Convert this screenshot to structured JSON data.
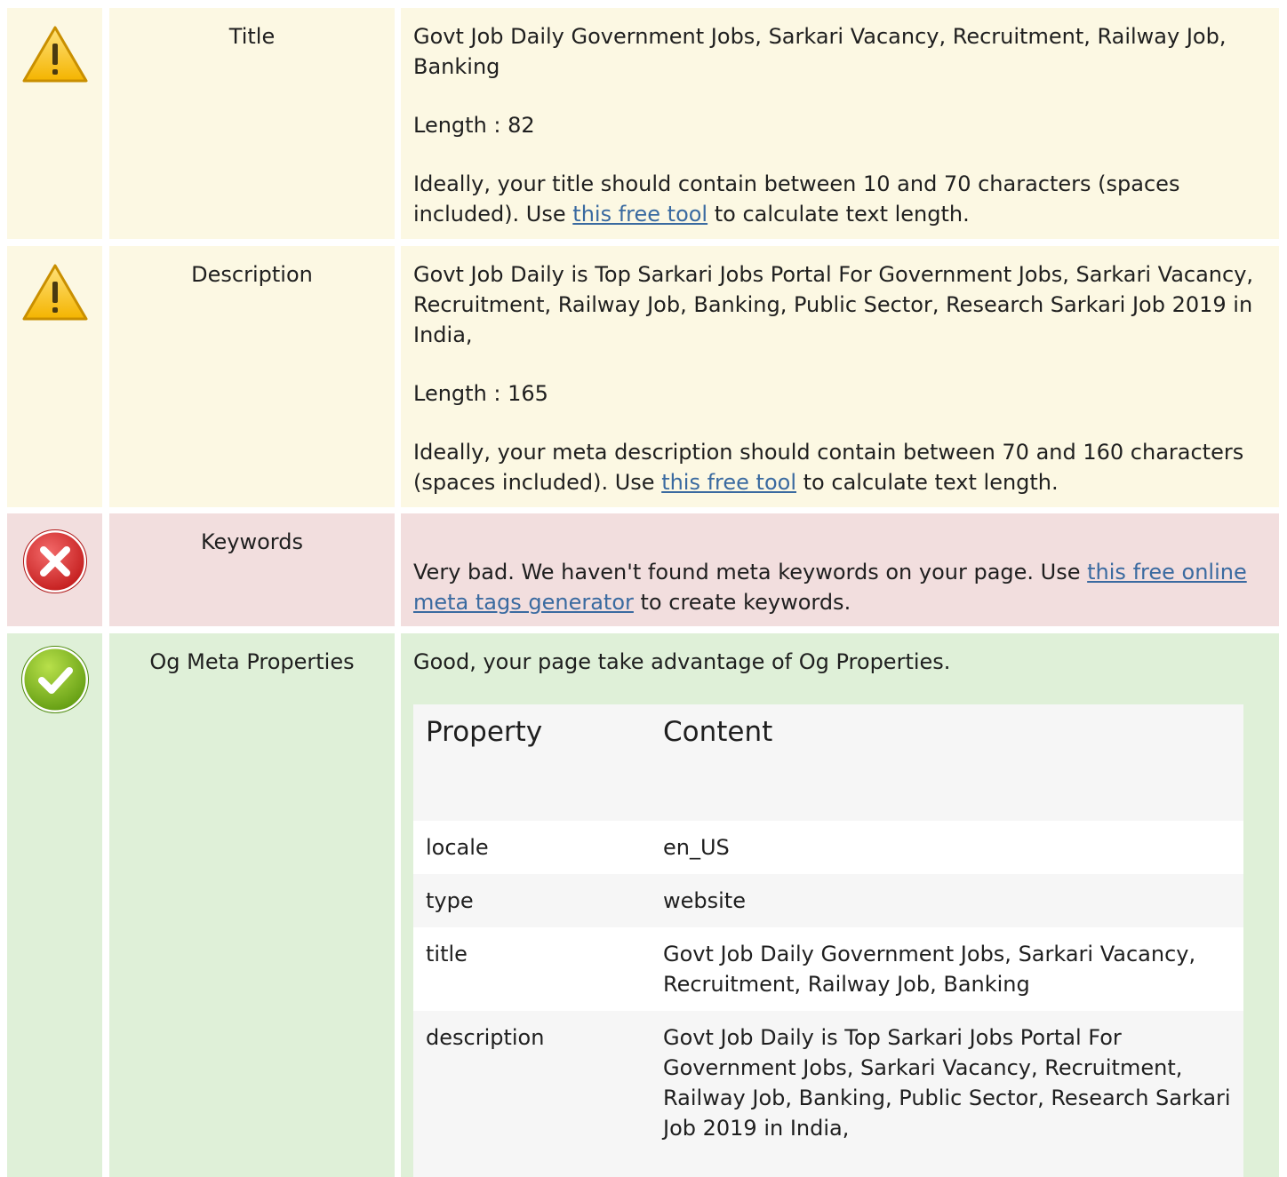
{
  "rows": {
    "title": {
      "status": "warning",
      "icon": "warning-icon",
      "label": "Title",
      "value": "Govt Job Daily Government Jobs, Sarkari Vacancy, Recruitment, Railway Job, Banking",
      "length": "Length : 82",
      "advice_pre": "Ideally, your title should contain between 10 and 70 characters (spaces included). Use ",
      "advice_link": "this free tool",
      "advice_post": " to calculate text length."
    },
    "description": {
      "status": "warning",
      "icon": "warning-icon",
      "label": "Description",
      "value": "Govt Job Daily is Top Sarkari Jobs Portal For Government Jobs, Sarkari Vacancy, Recruitment, Railway Job, Banking, Public Sector, Research Sarkari Job 2019 in India,",
      "length": "Length : 165",
      "advice_pre": "Ideally, your meta description should contain between 70 and 160 characters (spaces included). Use ",
      "advice_link": "this free tool",
      "advice_post": " to calculate text length."
    },
    "keywords": {
      "status": "error",
      "icon": "error-icon",
      "label": "Keywords",
      "advice_pre": "Very bad. We haven't found meta keywords on your page. Use ",
      "advice_link": "this free online meta tags generator",
      "advice_post": " to create keywords."
    },
    "og": {
      "status": "success",
      "icon": "check-icon",
      "label": "Og Meta Properties",
      "summary": "Good, your page take advantage of Og Properties.",
      "table": {
        "headers": [
          "Property",
          "Content"
        ],
        "rows": [
          [
            "locale",
            "en_US"
          ],
          [
            "type",
            "website"
          ],
          [
            "title",
            "Govt Job Daily Government Jobs, Sarkari Vacancy, Recruitment, Railway Job, Banking"
          ],
          [
            "description",
            "Govt Job Daily is Top Sarkari Jobs Portal For Government Jobs, Sarkari Vacancy, Recruitment, Railway Job, Banking, Public Sector, Research Sarkari Job 2019 in India,"
          ]
        ]
      }
    }
  },
  "colors": {
    "warning_bg": "#fcf8e3",
    "error_bg": "#f2dede",
    "success_bg": "#dff0d8",
    "link": "#3a6aa0"
  }
}
